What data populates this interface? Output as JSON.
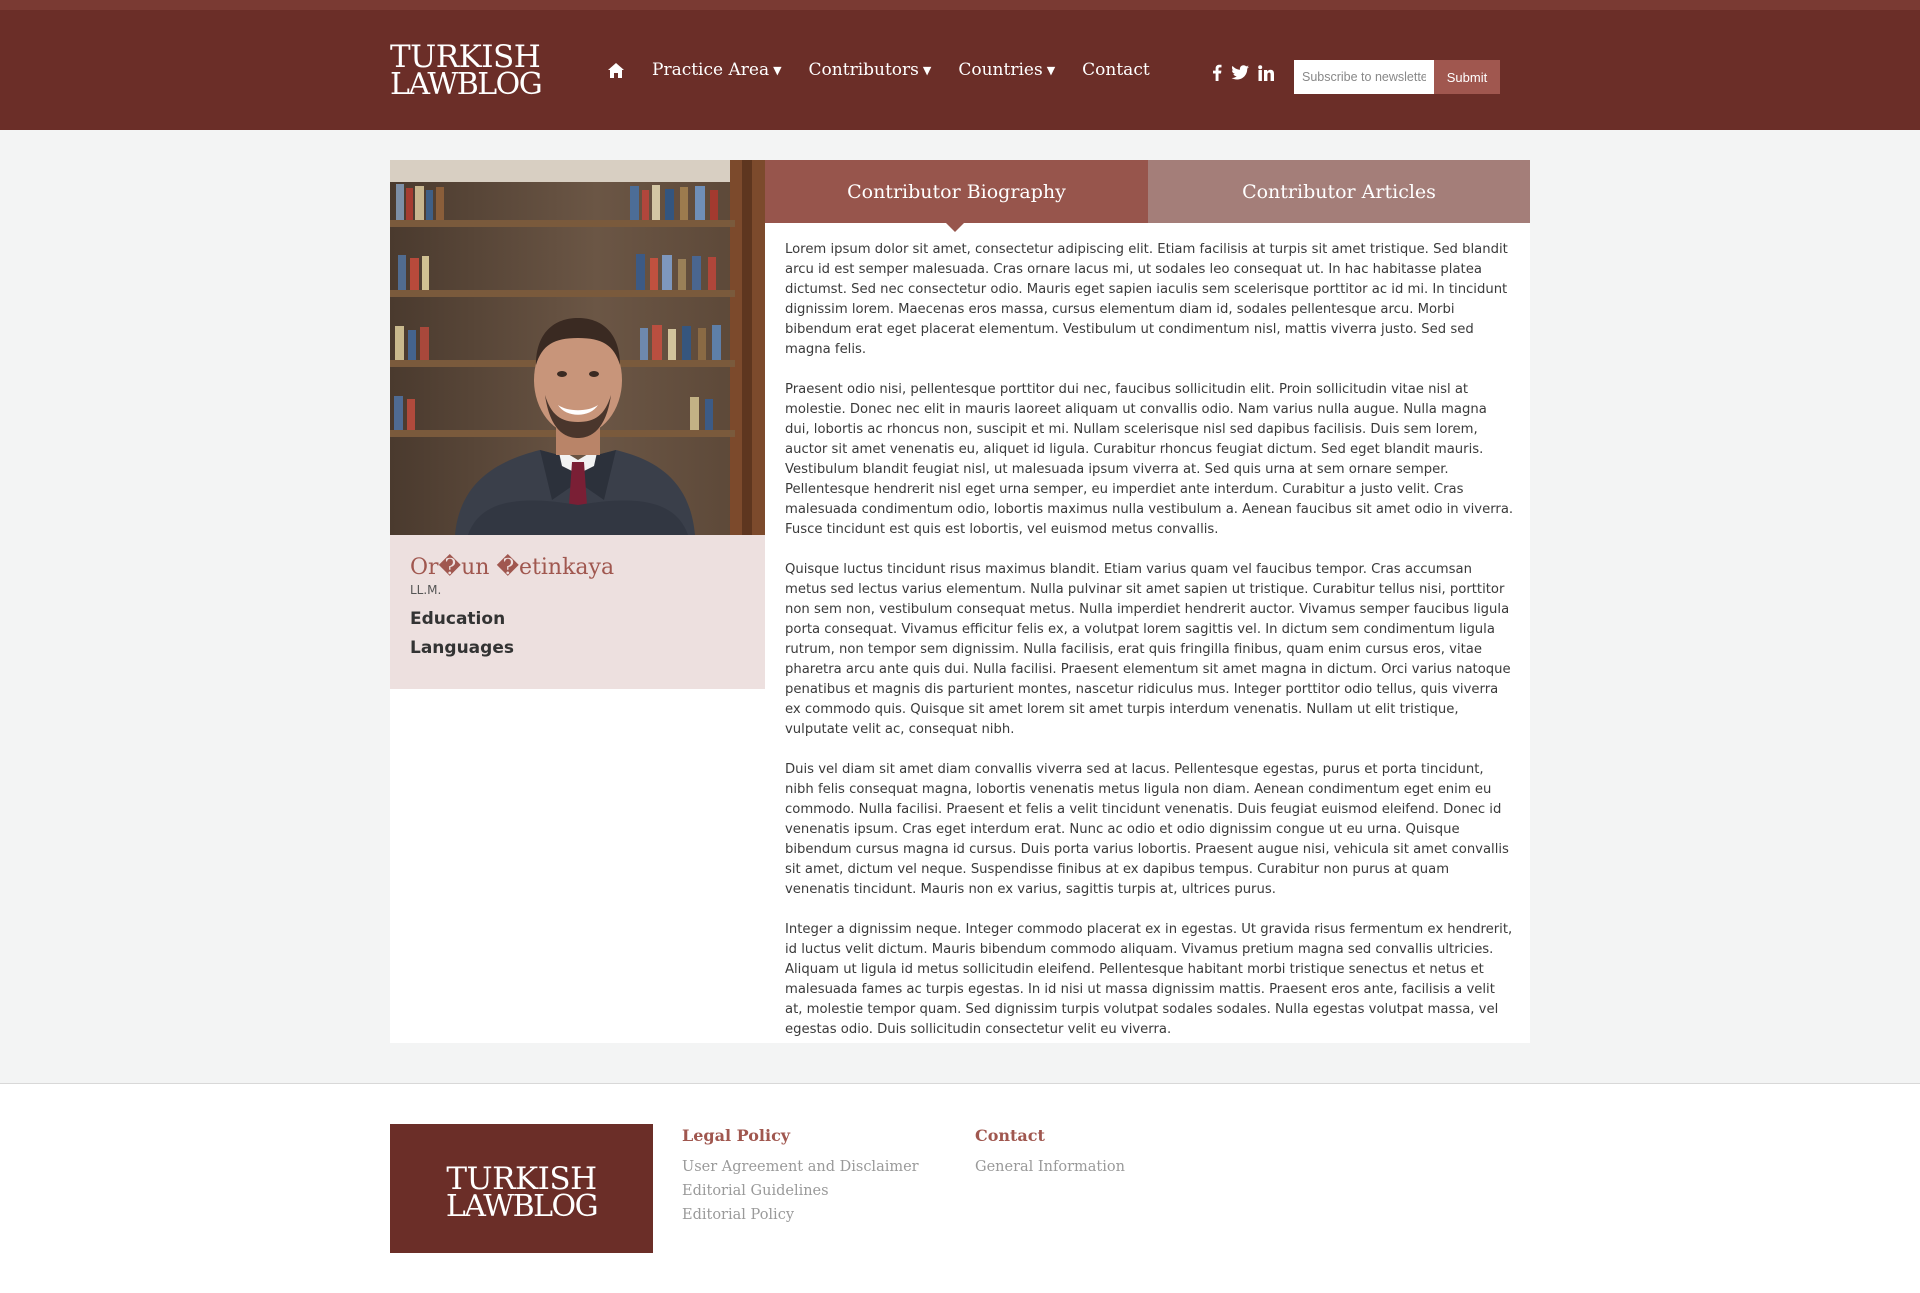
{
  "header": {
    "logo_line1": "TURKISH",
    "logo_line2": "LAWBLOG",
    "nav": [
      {
        "label": "Practice Area",
        "has_dropdown": true
      },
      {
        "label": "Contributors",
        "has_dropdown": true
      },
      {
        "label": "Countries",
        "has_dropdown": true
      },
      {
        "label": "Contact",
        "has_dropdown": false
      }
    ],
    "home_icon": "home-icon",
    "social_icons": [
      "facebook-icon",
      "twitter-icon",
      "linkedin-icon"
    ],
    "newsletter_placeholder": "Subscribe to newsletter",
    "newsletter_value": "",
    "submit_label": "Submit"
  },
  "profile": {
    "name": "Or�un �etinkaya",
    "degree": "LL.M.",
    "education_label": "Education",
    "languages_label": "Languages"
  },
  "tabs": {
    "biography": "Contributor Biography",
    "articles": "Contributor Articles"
  },
  "bio_paragraphs": [
    "Lorem ipsum dolor sit amet, consectetur adipiscing elit. Etiam facilisis at turpis sit amet tristique. Sed blandit arcu id est semper malesuada. Cras ornare lacus mi, ut sodales leo consequat ut. In hac habitasse platea dictumst. Sed nec consectetur odio. Mauris eget sapien iaculis sem scelerisque porttitor ac id mi. In tincidunt dignissim lorem. Maecenas eros massa, cursus elementum diam id, sodales pellentesque arcu. Morbi bibendum erat eget placerat elementum. Vestibulum ut condimentum nisl, mattis viverra justo. Sed sed magna felis.",
    "Praesent odio nisi, pellentesque porttitor dui nec, faucibus sollicitudin elit. Proin sollicitudin vitae nisl at molestie. Donec nec elit in mauris laoreet aliquam ut convallis odio. Nam varius nulla augue. Nulla magna dui, lobortis ac rhoncus non, suscipit et mi. Nullam scelerisque nisl sed dapibus facilisis. Duis sem lorem, auctor sit amet venenatis eu, aliquet id ligula. Curabitur rhoncus feugiat dictum. Sed eget blandit mauris. Vestibulum blandit feugiat nisl, ut malesuada ipsum viverra at. Sed quis urna at sem ornare semper. Pellentesque hendrerit nisl eget urna semper, eu imperdiet ante interdum. Curabitur a justo velit. Cras malesuada condimentum odio, lobortis maximus nulla vestibulum a. Aenean faucibus sit amet odio in viverra. Fusce tincidunt est quis est lobortis, vel euismod metus convallis.",
    "Quisque luctus tincidunt risus maximus blandit. Etiam varius quam vel faucibus tempor. Cras accumsan metus sed lectus varius elementum. Nulla pulvinar sit amet sapien ut tristique. Curabitur tellus nisi, porttitor non sem non, vestibulum consequat metus. Nulla imperdiet hendrerit auctor. Vivamus semper faucibus ligula porta consequat. Vivamus efficitur felis ex, a volutpat lorem sagittis vel. In dictum sem condimentum ligula rutrum, non tempor sem dignissim. Nulla facilisis, erat quis fringilla finibus, quam enim cursus eros, vitae pharetra arcu ante quis dui. Nulla facilisi. Praesent elementum sit amet magna in dictum. Orci varius natoque penatibus et magnis dis parturient montes, nascetur ridiculus mus. Integer porttitor odio tellus, quis viverra ex commodo quis. Quisque sit amet lorem sit amet turpis interdum venenatis. Nullam ut elit tristique, vulputate velit ac, consequat nibh.",
    "Duis vel diam sit amet diam convallis viverra sed at lacus. Pellentesque egestas, purus et porta tincidunt, nibh felis consequat magna, lobortis venenatis metus ligula non diam. Aenean condimentum eget enim eu commodo. Nulla facilisi. Praesent et felis a velit tincidunt venenatis. Duis feugiat euismod eleifend. Donec id venenatis ipsum. Cras eget interdum erat. Nunc ac odio et odio dignissim congue ut eu urna. Quisque bibendum cursus magna id cursus. Duis porta varius lobortis. Praesent augue nisi, vehicula sit amet convallis sit amet, dictum vel neque. Suspendisse finibus at ex dapibus tempus. Curabitur non purus at quam venenatis tincidunt. Mauris non ex varius, sagittis turpis at, ultrices purus.",
    "Integer a dignissim neque. Integer commodo placerat ex in egestas. Ut gravida risus fermentum ex hendrerit, id luctus velit dictum. Mauris bibendum commodo aliquam. Vivamus pretium magna sed convallis ultricies. Aliquam ut ligula id metus sollicitudin eleifend. Pellentesque habitant morbi tristique senectus et netus et malesuada fames ac turpis egestas. In id nisi ut massa dignissim mattis. Praesent eros ante, facilisis a velit at, molestie tempor quam. Sed dignissim turpis volutpat sodales sodales. Nulla egestas volutpat massa, vel egestas odio. Duis sollicitudin consectetur velit eu viverra."
  ],
  "footer": {
    "logo_line1": "TURKISH",
    "logo_line2": "LAWBLOG",
    "legal": {
      "heading": "Legal Policy",
      "links": [
        "User Agreement and Disclaimer",
        "Editorial Guidelines",
        "Editorial Policy"
      ]
    },
    "contact": {
      "heading": "Contact",
      "links": [
        "General Information"
      ]
    }
  },
  "colors": {
    "header_bg": "#6b2e28",
    "accent": "#a0574f",
    "tab_active": "#97554c",
    "tab_inactive": "#a47e79",
    "profile_bg": "#ede0df"
  }
}
